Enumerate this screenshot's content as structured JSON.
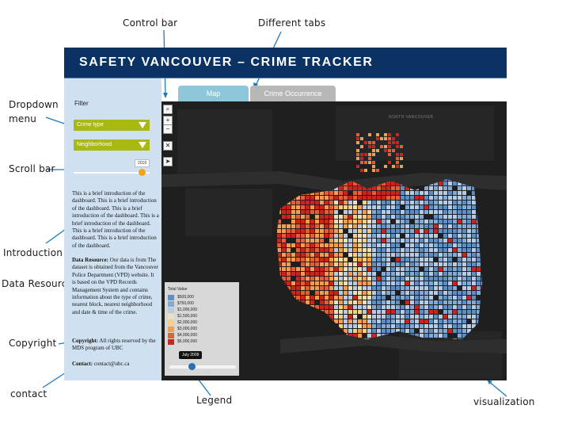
{
  "annotations": {
    "control_bar": "Control bar",
    "different_tabs": "Different tabs",
    "dropdown_menu_line1": "Dropdown",
    "dropdown_menu_line2": "menu",
    "scroll_bar": "Scroll bar",
    "introduction": "Introduction",
    "data_resource": "Data Resource",
    "copyright": "Copyright",
    "contact": "contact",
    "legend": "Legend",
    "visualization": "visualization"
  },
  "header": {
    "title": "SAFETY VANCOUVER – CRIME TRACKER"
  },
  "sidebar": {
    "filter_label": "Filter",
    "dropdown_crime_type": "Crime type",
    "dropdown_neighborhood": "Neighborhood",
    "year_value": "2016",
    "year_fraction": 0.9,
    "intro_text": "This is a brief introduction of the dashboard. This is a brief introduction of the dashboard. This is a brief introduction of the dashboard. This is a brief introduction of the dashboard. This is a brief introduction of the dashboard. This is a brief introduction of the dashboard.",
    "data_resource_label": "Data Resource:",
    "data_resource_text": " Our data is from The dataset is obtained from the Vancouver Police Department (VPD) website. It is based on the VPD Records Management System and contains information about the type of crime, nearest block, nearest neighborhood and date & time of the crime.",
    "copyright_label": "Copyright:",
    "copyright_text": " All rights reserved by the MDS program of UBC",
    "contact_label": "Contact:",
    "contact_text": " contact@ubc.ca"
  },
  "tabs": [
    {
      "label": "Map",
      "active": true
    },
    {
      "label": "Crime Occurrence",
      "active": false
    }
  ],
  "map": {
    "place_labels": [
      "NORTH VANCOUVER"
    ],
    "controls": [
      "search-icon",
      "zoom-in-icon",
      "zoom-out-icon",
      "close-icon",
      "locate-icon"
    ],
    "colors": {
      "background": "#1f1f1f",
      "water": "#2e2e2e"
    }
  },
  "legend": {
    "title": "Total Value",
    "items": [
      {
        "label": "$500,000",
        "color": "#5f8fc0"
      },
      {
        "label": "$750,000",
        "color": "#86a9cf"
      },
      {
        "label": "$1,000,000",
        "color": "#b9cbe0"
      },
      {
        "label": "$1,500,000",
        "color": "#ecdfbe"
      },
      {
        "label": "$2,000,000",
        "color": "#f1d089"
      },
      {
        "label": "$3,000,000",
        "color": "#ed9f58"
      },
      {
        "label": "$4,000,000",
        "color": "#e0603a"
      },
      {
        "label": "$5,000,000",
        "color": "#c5261f"
      }
    ],
    "time_value": "July 2009",
    "time_fraction": 0.33
  },
  "colors": {
    "header_bg": "#0a3363",
    "sidebar_bg": "#cfe0f1",
    "dropdown_bg": "#aab812",
    "tab_active": "#8fc7da",
    "tab_inactive": "#b7b7b7"
  }
}
